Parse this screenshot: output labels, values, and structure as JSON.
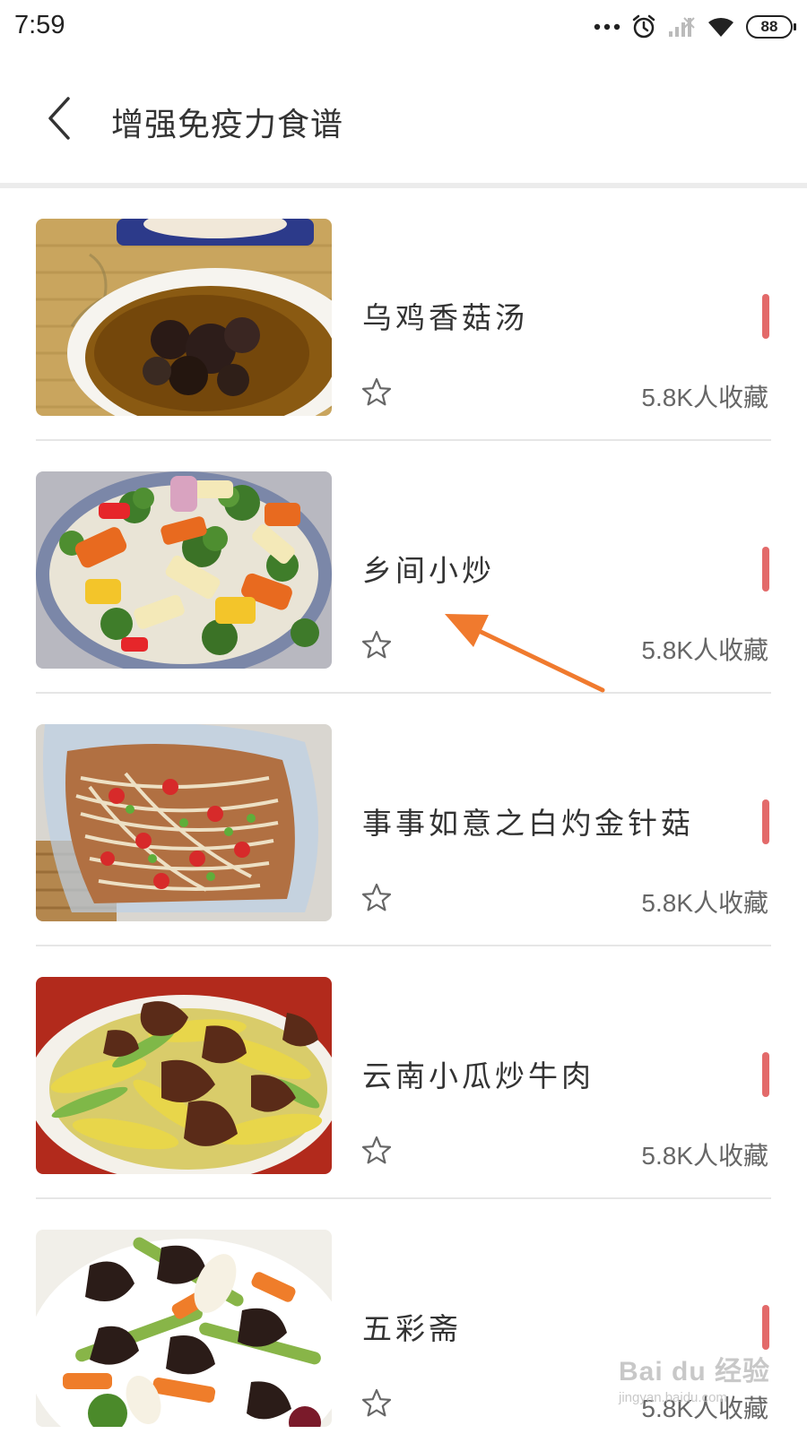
{
  "status_bar": {
    "time": "7:59",
    "battery": "88",
    "icons": [
      "more-dots-icon",
      "alarm-icon",
      "signal-icon",
      "wifi-icon",
      "battery-icon"
    ]
  },
  "header": {
    "title": "增强免疫力食谱",
    "back_icon": "chevron-left-icon"
  },
  "recipes": [
    {
      "title": "乌鸡香菇汤",
      "favorites": "5.8K人收藏"
    },
    {
      "title": "乡间小炒",
      "favorites": "5.8K人收藏"
    },
    {
      "title": "事事如意之白灼金针菇",
      "favorites": "5.8K人收藏"
    },
    {
      "title": "云南小瓜炒牛肉",
      "favorites": "5.8K人收藏"
    },
    {
      "title": "五彩斋",
      "favorites": "5.8K人收藏"
    }
  ],
  "colors": {
    "accent_marker": "#e36a6a",
    "annotation_arrow": "#f07a2e"
  },
  "watermark": {
    "main": "Bai du 经验",
    "sub": "jingyan.baidu.com"
  }
}
